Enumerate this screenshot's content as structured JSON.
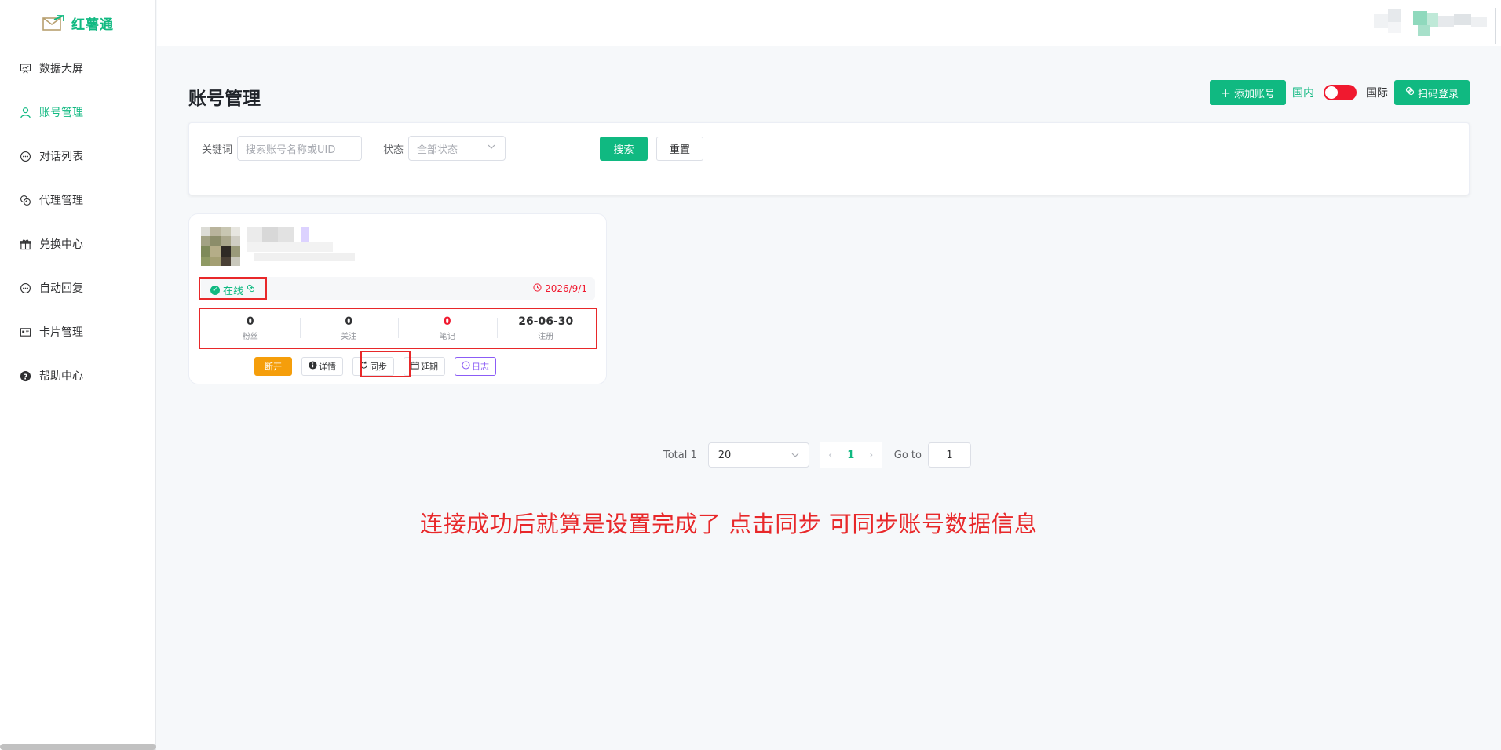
{
  "app": {
    "name": "红薯通"
  },
  "sidebar": {
    "items": [
      {
        "label": "数据大屏",
        "icon": "dashboard-icon",
        "active": false
      },
      {
        "label": "账号管理",
        "icon": "user-icon",
        "active": true
      },
      {
        "label": "对话列表",
        "icon": "chat-icon",
        "active": false
      },
      {
        "label": "代理管理",
        "icon": "proxy-icon",
        "active": false
      },
      {
        "label": "兑换中心",
        "icon": "gift-icon",
        "active": false
      },
      {
        "label": "自动回复",
        "icon": "reply-icon",
        "active": false
      },
      {
        "label": "卡片管理",
        "icon": "card-icon",
        "active": false
      },
      {
        "label": "帮助中心",
        "icon": "help-icon",
        "active": false
      }
    ]
  },
  "page": {
    "title": "账号管理"
  },
  "header_actions": {
    "add_account": "添加账号",
    "domestic": "国内",
    "international": "国际",
    "scan_login": "扫码登录"
  },
  "filters": {
    "keyword_label": "关键词",
    "keyword_placeholder": "搜索账号名称或UID",
    "status_label": "状态",
    "status_value": "全部状态",
    "search_button": "搜索",
    "reset_button": "重置"
  },
  "account": {
    "status": "在线",
    "expire_date": "2026/9/1",
    "stats": [
      {
        "value": "0",
        "label": "粉丝",
        "highlight": false
      },
      {
        "value": "0",
        "label": "关注",
        "highlight": false
      },
      {
        "value": "0",
        "label": "笔记",
        "highlight": true
      },
      {
        "value": "26-06-30",
        "label": "注册",
        "highlight": false
      }
    ],
    "actions": {
      "disconnect": "断开",
      "details": "详情",
      "sync": "同步",
      "extend": "延期",
      "log": "日志"
    }
  },
  "pagination": {
    "total_text": "Total 1",
    "page_size": "20",
    "current_page": "1",
    "goto_label": "Go to",
    "goto_value": "1"
  },
  "annotation": "连接成功后就算是设置完成了 点击同步 可同步账号数据信息",
  "colors": {
    "accent": "#10b981",
    "danger": "#f0192f",
    "warning": "#f59e0b",
    "purple": "#8b5cf6"
  }
}
